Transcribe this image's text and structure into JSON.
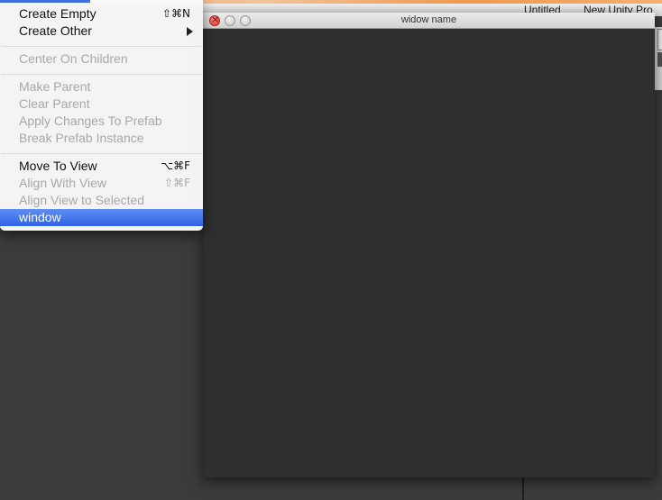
{
  "background_window": {
    "tabs": [
      "Untitled",
      "New Unity Pro"
    ]
  },
  "window": {
    "title": "widow name"
  },
  "menu": {
    "items": [
      {
        "label": "Create Empty",
        "shortcut": "⇧⌘N",
        "enabled": true
      },
      {
        "label": "Create Other",
        "submenu": true,
        "enabled": true
      },
      {
        "label": "Center On Children",
        "enabled": false
      },
      {
        "label": "Make Parent",
        "enabled": false
      },
      {
        "label": "Clear Parent",
        "enabled": false
      },
      {
        "label": "Apply Changes To Prefab",
        "enabled": false
      },
      {
        "label": "Break Prefab Instance",
        "enabled": false
      },
      {
        "label": "Move To View",
        "shortcut": "⌥⌘F",
        "enabled": true
      },
      {
        "label": "Align With View",
        "shortcut": "⇧⌘F",
        "enabled": false
      },
      {
        "label": "Align View to Selected",
        "enabled": false
      },
      {
        "label": "window",
        "enabled": true,
        "highlighted": true
      }
    ]
  },
  "colors": {
    "highlight": "#3c6fe0",
    "disabled_text": "#a8a8a8",
    "window_bg": "#2f2f2f"
  }
}
